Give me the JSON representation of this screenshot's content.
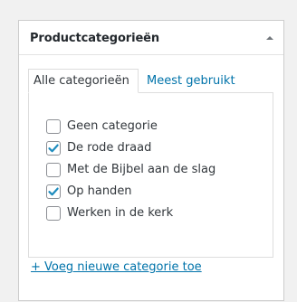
{
  "box": {
    "title": "Productcategorieën",
    "toggle_icon": "triangle-up-icon"
  },
  "tabs": [
    {
      "label": "Alle categorieën",
      "active": true
    },
    {
      "label": "Meest gebruikt",
      "active": false
    }
  ],
  "categories": [
    {
      "label": "Geen categorie",
      "checked": false
    },
    {
      "label": "De rode draad",
      "checked": true
    },
    {
      "label": "Met de Bijbel aan de slag",
      "checked": false
    },
    {
      "label": "Op handen",
      "checked": true
    },
    {
      "label": "Werken in de kerk",
      "checked": false
    }
  ],
  "add_link": "+ Voeg nieuwe categorie toe",
  "colors": {
    "link": "#0073aa",
    "checkmark": "#1e8cbe",
    "border": "#cccccc"
  }
}
